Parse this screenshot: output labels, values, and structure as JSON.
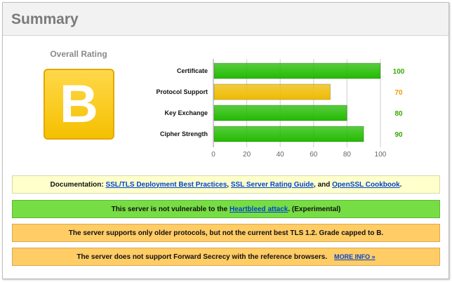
{
  "header": {
    "title": "Summary"
  },
  "rating": {
    "label": "Overall Rating",
    "grade": "B"
  },
  "chart_data": {
    "type": "bar",
    "orientation": "horizontal",
    "categories": [
      "Certificate",
      "Protocol Support",
      "Key Exchange",
      "Cipher Strength"
    ],
    "values": [
      100,
      70,
      80,
      90
    ],
    "value_labels": [
      "100",
      "70",
      "80",
      "90"
    ],
    "colors": [
      "#22bb00",
      "#eebb00",
      "#22bb00",
      "#22bb00"
    ],
    "value_colors": [
      "#33aa00",
      "#ee9900",
      "#33aa00",
      "#33aa00"
    ],
    "xlim": [
      0,
      100
    ],
    "ticks": [
      "0",
      "20",
      "40",
      "60",
      "80",
      "100"
    ],
    "grid": true
  },
  "notices": {
    "doc": {
      "prefix": "Documentation: ",
      "link1": "SSL/TLS Deployment Best Practices",
      "sep1": ", ",
      "link2": "SSL Server Rating Guide",
      "sep2": ", and ",
      "link3": "OpenSSL Cookbook",
      "suffix": "."
    },
    "heartbleed": {
      "prefix": "This server is not vulnerable to the ",
      "link": "Heartbleed attack",
      "suffix": ". (Experimental)"
    },
    "protocols": {
      "text": "The server supports only older protocols, but not the current best TLS 1.2. Grade capped to B."
    },
    "forward_secrecy": {
      "text": "The server does not support Forward Secrecy with the reference browsers.",
      "more": "MORE INFO »"
    }
  }
}
